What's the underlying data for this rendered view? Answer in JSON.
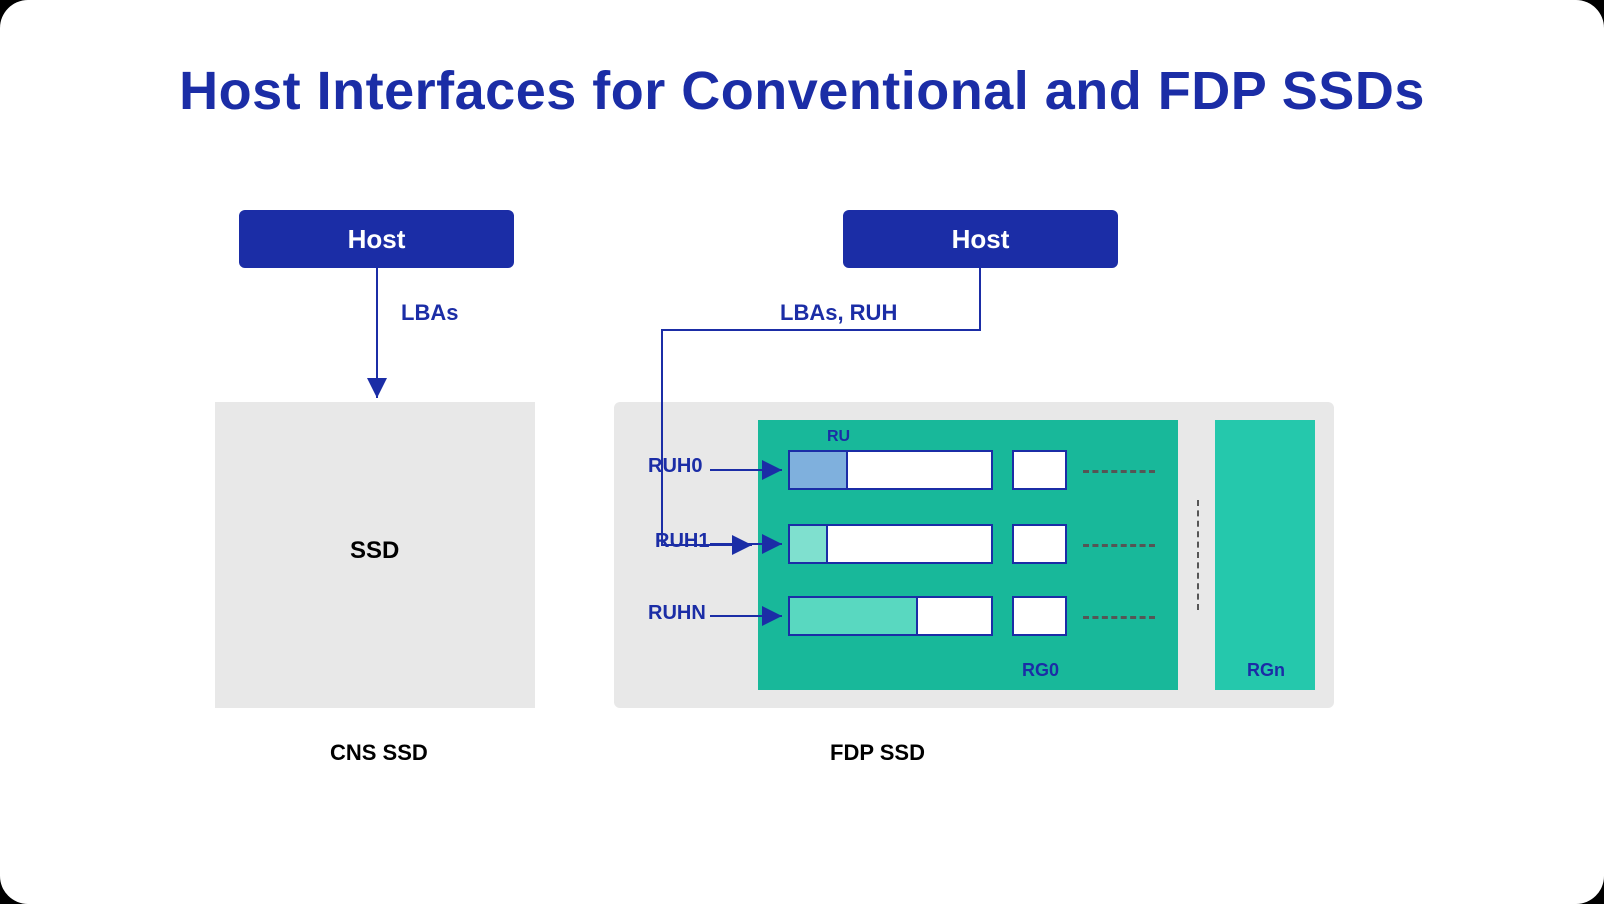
{
  "title": "Host Interfaces for Conventional and FDP SSDs",
  "left": {
    "host": "Host",
    "edge": "LBAs",
    "ssd": "SSD",
    "caption": "CNS SSD"
  },
  "right": {
    "host": "Host",
    "edge": "LBAs, RUH",
    "ruh0": "RUH0",
    "ruh1": "RUH1",
    "ruhn": "RUHN",
    "ru": "RU",
    "rg0": "RG0",
    "rgn": "RGn",
    "caption": "FDP SSD"
  }
}
